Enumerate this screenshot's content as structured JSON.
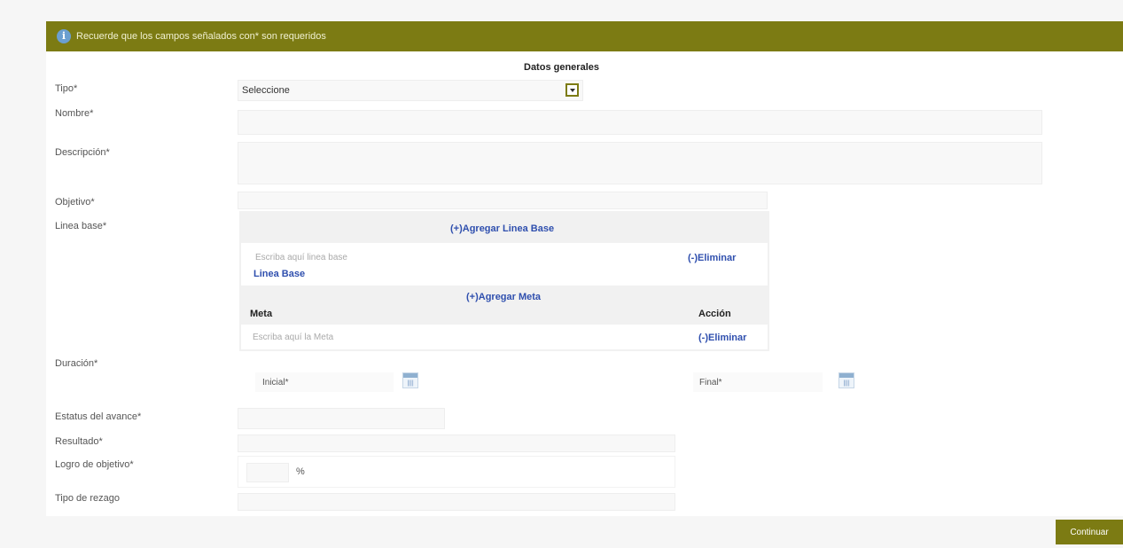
{
  "banner": {
    "text": "Recuerde que los campos señalados con* son requeridos"
  },
  "section": {
    "title": "Datos generales"
  },
  "fields": {
    "tipo": {
      "label": "Tipo*",
      "value": "Seleccione"
    },
    "nombre": {
      "label": "Nombre*"
    },
    "descripcion": {
      "label": "Descripción*"
    },
    "objetivo": {
      "label": "Objetivo*"
    },
    "linea_base": {
      "label": "Linea base*",
      "add_link": "(+)Agregar Linea Base",
      "placeholder": "Escriba aquí linea base",
      "remove_link": "(-)Eliminar",
      "tag": "Linea Base"
    },
    "meta": {
      "add_link": "(+)Agregar Meta",
      "col_meta": "Meta",
      "col_accion": "Acción",
      "placeholder": "Escriba aquí la Meta",
      "remove_link": "(-)Eliminar"
    },
    "duracion": {
      "label": "Duración*",
      "inicial": "Inicial*",
      "final": "Final*",
      "cal_num": "||||"
    },
    "estatus": {
      "label": "Estatus del avance*"
    },
    "resultado": {
      "label": "Resultado*"
    },
    "logro": {
      "label": "Logro de objetivo*",
      "unit": "%"
    },
    "tipo_rezago": {
      "label": "Tipo de rezago"
    }
  },
  "buttons": {
    "continuar": "Continuar"
  },
  "colors": {
    "accent": "#7c7b13",
    "link": "#2f4fae"
  }
}
